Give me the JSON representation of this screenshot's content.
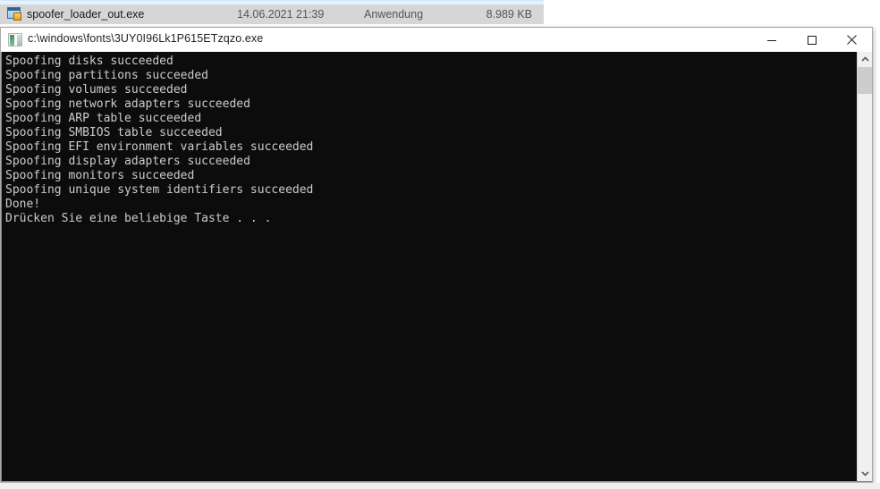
{
  "explorer": {
    "selected_row": {
      "icon": "exe-application-icon",
      "name": "spoofer_loader_out.exe",
      "date": "14.06.2021 21:39",
      "type": "Anwendung",
      "size": "8.989 KB"
    }
  },
  "console_window": {
    "icon": "console-app-icon",
    "title": "c:\\windows\\fonts\\3UY0I96Lk1P615ETzqzo.exe",
    "controls": {
      "minimize_label": "Minimieren",
      "maximize_label": "Maximieren",
      "close_label": "Schließen"
    },
    "scrollbar": {
      "up_arrow_label": "Nach oben scrollen",
      "down_arrow_label": "Nach unten scrollen"
    },
    "output_lines": [
      "Spoofing disks succeeded",
      "Spoofing partitions succeeded",
      "Spoofing volumes succeeded",
      "Spoofing network adapters succeeded",
      "Spoofing ARP table succeeded",
      "Spoofing SMBIOS table succeeded",
      "Spoofing EFI environment variables succeeded",
      "Spoofing display adapters succeeded",
      "Spoofing monitors succeeded",
      "Spoofing unique system identifiers succeeded",
      "Done!",
      "Drücken Sie eine beliebige Taste . . ."
    ]
  },
  "colors": {
    "console_background": "#0c0c0c",
    "console_text": "#cccccc",
    "explorer_selected_row": "#d6d6d6",
    "explorer_partial_row": "#e7f3fc",
    "scrollbar_thumb": "#cdcdcd",
    "scrollbar_track": "#f0f0f0",
    "window_border": "#a8a8a8"
  }
}
